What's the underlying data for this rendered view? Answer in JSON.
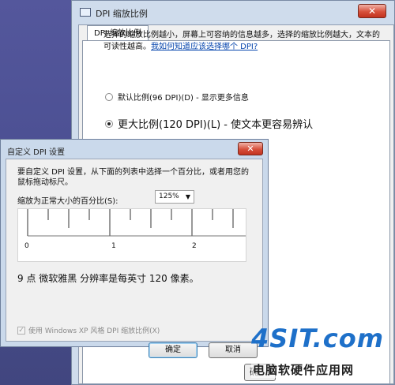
{
  "back_window": {
    "title": "DPI 缩放比例",
    "tab_label": "DPI 缩放比例",
    "description": "选择的缩放比例越小，屏幕上可容纳的信息越多，选择的缩放比例越大，文本的可读性越高。",
    "link_text": "我如何知道应该选择哪个 DPI?",
    "options": [
      {
        "label": "默认比例(96 DPI)(D) - 显示更多信息",
        "checked": false
      },
      {
        "label": "更大比例(120 DPI)(L) - 使文本更容易辨认",
        "checked": true
      }
    ],
    "partial_button": "确"
  },
  "custom_dialog": {
    "title": "自定义 DPI 设置",
    "description": "要自定义 DPI 设置，从下面的列表中选择一个百分比，或者用您的鼠标拖动标尺。",
    "scale_label": "缩放为正常大小的百分比(S):",
    "scale_value": "125%",
    "ruler_numbers": [
      "0",
      "1",
      "2"
    ],
    "result_text": "9 点 微软雅黑 分辨率是每英寸 120 像素。",
    "xp_checkbox_label": "使用 Windows XP 风格 DPI 缩放比例(X)",
    "xp_checked": true,
    "ok_label": "确定",
    "cancel_label": "取消"
  },
  "watermark": {
    "logo": "4SIT.com",
    "subtitle": "电脑软硬件应用网"
  }
}
